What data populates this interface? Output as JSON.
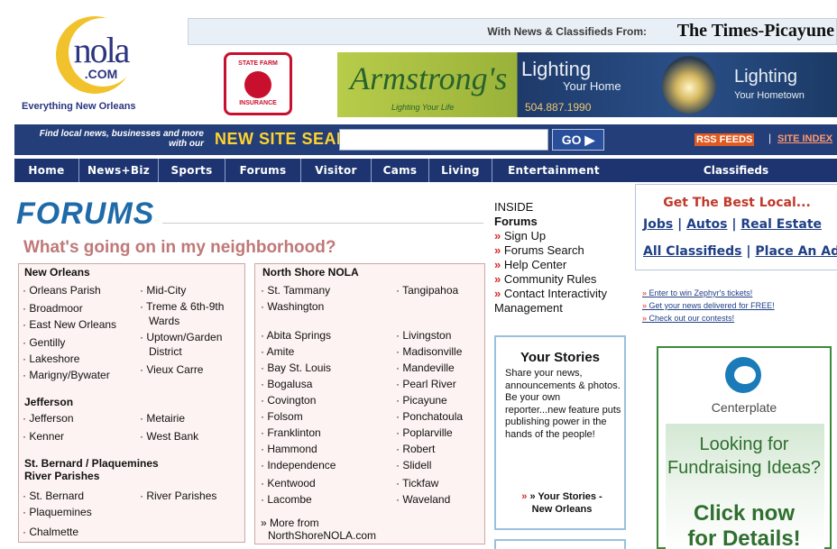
{
  "header": {
    "logo_text": "nola",
    "logo_com": ".COM",
    "logo_tagline": "Everything New Orleans",
    "with_news": "With News & Classifieds From:",
    "newspaper": "The Times-Picayune",
    "sponsor1_top": "STATE FARM",
    "sponsor1_bottom": "INSURANCE",
    "ad_brand": "Armstrong's",
    "ad_slogan": "Lighting Your Life",
    "ad_lighting": "Lighting",
    "ad_your_home": "Your Home",
    "ad_phone": "504.887.1990",
    "ad_lighting2": "Lighting",
    "ad_your_hometown": "Your Hometown"
  },
  "search": {
    "find_text": "Find local news, businesses and more with our",
    "new_label": "NEW SITE SEARCH:",
    "input_value": "",
    "go_label": "GO ▶",
    "rss_label": "RSS FEEDS",
    "sep": "|",
    "site_index_label": "SITE INDEX"
  },
  "nav": {
    "items": [
      {
        "label": "Home"
      },
      {
        "label": "News+Biz"
      },
      {
        "label": "Sports"
      },
      {
        "label": "Forums"
      },
      {
        "label": "Visitor"
      },
      {
        "label": "Cams"
      },
      {
        "label": "Living"
      },
      {
        "label": "Entertainment"
      }
    ],
    "classifieds_label": "Classifieds"
  },
  "forums": {
    "title": "FORUMS",
    "subtitle": "What's going on in my neighborhood?",
    "new_orleans": {
      "heading": "New Orleans",
      "left": [
        "Orleans Parish",
        "Broadmoor",
        "East New Orleans",
        "Gentilly",
        "Lakeshore",
        "Marigny/Bywater"
      ],
      "right": [
        "Mid-City",
        "Treme & 6th-9th",
        "Wards",
        "Uptown/Garden",
        "District",
        "Vieux Carre"
      ]
    },
    "jefferson": {
      "heading": "Jefferson",
      "left": [
        "Jefferson",
        "Kenner"
      ],
      "right": [
        "Metairie",
        "West Bank"
      ]
    },
    "stbernard": {
      "heading_line1": "St. Bernard / Plaquemines",
      "heading_line2": "River Parishes",
      "left": [
        "St. Bernard",
        "Plaquemines",
        "Chalmette"
      ],
      "right": [
        "River Parishes"
      ]
    },
    "north_shore": {
      "heading": "North Shore NOLA",
      "top_left": [
        "St. Tammany",
        "Washington"
      ],
      "top_right": [
        "Tangipahoa"
      ],
      "left": [
        "Abita Springs",
        "Amite",
        "Bay St. Louis",
        "Bogalusa",
        "Covington",
        "Folsom",
        "Franklinton",
        "Hammond",
        "Independence",
        "Kentwood",
        "Lacombe"
      ],
      "right": [
        "Livingston",
        "Madisonville",
        "Mandeville",
        "Pearl River",
        "Picayune",
        "Ponchatoula",
        "Poplarville",
        "Robert",
        "Slidell",
        "Tickfaw",
        "Waveland"
      ],
      "more_line1": "» More from",
      "more_line2": "NorthShoreNOLA.com"
    }
  },
  "inside": {
    "label": "INSIDE",
    "heading": "Forums",
    "links": [
      "Sign Up",
      "Forums Search",
      "Help Center",
      "Community Rules",
      "Contact Interactivity"
    ],
    "tail": "Management"
  },
  "stories": {
    "title": "Your Stories",
    "body": "Share your news, announcements & photos. Be your own reporter...new feature puts publishing power in the hands of the people!",
    "link_line1": "» Your Stories -",
    "link_line2": "New Orleans"
  },
  "classifieds": {
    "best": "Get The Best Local...",
    "jobs": "Jobs",
    "autos": "Autos",
    "real_estate": "Real Estate",
    "all": "All Classifieds",
    "place": "Place An Ad",
    "sep": "|"
  },
  "promos": [
    "Enter to win Zephyr's tickets!",
    "Get your news delivered for FREE!",
    "Check out our contests!"
  ],
  "ad": {
    "company": "Centerplate",
    "line1": "Looking for",
    "line2": "Fundraising Ideas?",
    "line3": "Click now",
    "line4": "for Details!"
  },
  "colors": {
    "navy": "#1d3470",
    "forums_blue": "#1f6aa8",
    "neighborhood_pink": "#c07878",
    "link_red": "#d32f2f",
    "classifieds_blue": "#1f3f86"
  }
}
